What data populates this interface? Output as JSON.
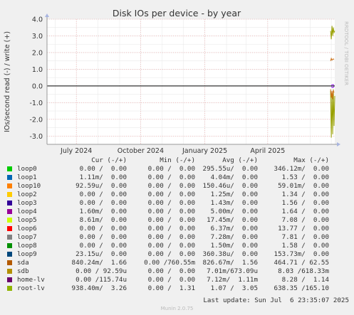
{
  "chart_data": {
    "type": "line",
    "title": "Disk IOs per device - by year",
    "ylabel": "IOs/second read (-) / write (+)",
    "ylim": [
      -3.5,
      4.0
    ],
    "yticks": [
      "4.0",
      "3.0",
      "2.0",
      "1.0",
      "0.0",
      "-1.0",
      "-2.0",
      "-3.0"
    ],
    "ytick_values": [
      4,
      3,
      2,
      1,
      0,
      -1,
      -2,
      -3
    ],
    "xlim": [
      "2024-05-20",
      "2025-07-06"
    ],
    "xticks": [
      {
        "label": "July 2024",
        "date": "2024-07-01"
      },
      {
        "label": "October 2024",
        "date": "2024-10-01"
      },
      {
        "label": "January 2025",
        "date": "2025-01-01"
      },
      {
        "label": "April 2025",
        "date": "2025-04-01"
      }
    ],
    "grid": true,
    "side_label": "RRDTOOL / TOBI OETIKER",
    "series": [
      {
        "name": "root-lv",
        "color": "#98a000",
        "x": [
          "2025-06-30",
          "2025-07-01",
          "2025-07-02",
          "2025-07-03",
          "2025-07-04",
          "2025-07-05",
          "2025-07-06"
        ],
        "write": [
          3.3,
          2.8,
          3.6,
          3.0,
          3.5,
          3.2,
          3.3
        ],
        "read": [
          -0.3,
          -3.1,
          -0.4,
          -2.9,
          -0.2,
          -2.4,
          -0.6
        ]
      },
      {
        "name": "sda",
        "color": "#cc7016",
        "x": [
          "2025-06-30",
          "2025-07-01",
          "2025-07-02",
          "2025-07-03",
          "2025-07-04",
          "2025-07-05"
        ],
        "write": [
          1.5,
          1.65,
          1.55,
          1.6,
          1.62,
          1.58
        ],
        "read": [
          -0.2,
          -0.7,
          -0.3,
          -0.8,
          -0.25,
          -0.4
        ]
      },
      {
        "name": "home-lv",
        "color": "#8c00ff",
        "x": [
          "2025-07-01",
          "2025-07-03",
          "2025-07-05"
        ],
        "write": [
          0.05,
          0.08,
          0.06
        ],
        "read": [
          -0.05,
          -0.1,
          -0.04
        ]
      }
    ]
  },
  "legend": {
    "headers": [
      "Cur (-/+)",
      "Min (-/+)",
      "Avg (-/+)",
      "Max (-/+)"
    ],
    "rows": [
      {
        "name": "loop0",
        "color": "#00cc00",
        "cur": "0.00 /  0.00",
        "min": "0.00 /  0.00",
        "avg": "295.55u/  0.00",
        "max": "346.12m/  0.00"
      },
      {
        "name": "loop1",
        "color": "#0066b3",
        "cur": "1.11m/  0.00",
        "min": "0.00 /  0.00",
        "avg": "4.04m/  0.00",
        "max": "1.53 /  0.00"
      },
      {
        "name": "loop10",
        "color": "#ff8000",
        "cur": "92.59u/  0.00",
        "min": "0.00 /  0.00",
        "avg": "150.46u/  0.00",
        "max": "59.01m/  0.00"
      },
      {
        "name": "loop2",
        "color": "#ffcc00",
        "cur": "0.00 /  0.00",
        "min": "0.00 /  0.00",
        "avg": "1.25m/  0.00",
        "max": "1.34 /  0.00"
      },
      {
        "name": "loop3",
        "color": "#330099",
        "cur": "0.00 /  0.00",
        "min": "0.00 /  0.00",
        "avg": "1.43m/  0.00",
        "max": "1.56 /  0.00"
      },
      {
        "name": "loop4",
        "color": "#990099",
        "cur": "1.60m/  0.00",
        "min": "0.00 /  0.00",
        "avg": "5.00m/  0.00",
        "max": "1.64 /  0.00"
      },
      {
        "name": "loop5",
        "color": "#ccff00",
        "cur": "8.61m/  0.00",
        "min": "0.00 /  0.00",
        "avg": "17.45m/  0.00",
        "max": "7.08 /  0.00"
      },
      {
        "name": "loop6",
        "color": "#ff0000",
        "cur": "0.00 /  0.00",
        "min": "0.00 /  0.00",
        "avg": "6.37m/  0.00",
        "max": "13.77 /  0.00"
      },
      {
        "name": "loop7",
        "color": "#808080",
        "cur": "0.00 /  0.00",
        "min": "0.00 /  0.00",
        "avg": "7.28m/  0.00",
        "max": "7.81 /  0.00"
      },
      {
        "name": "loop8",
        "color": "#008f00",
        "cur": "0.00 /  0.00",
        "min": "0.00 /  0.00",
        "avg": "1.50m/  0.00",
        "max": "1.58 /  0.00"
      },
      {
        "name": "loop9",
        "color": "#00487d",
        "cur": "23.15u/  0.00",
        "min": "0.00 /  0.00",
        "avg": "360.38u/  0.00",
        "max": "153.73m/  0.00"
      },
      {
        "name": "sda",
        "color": "#b35a00",
        "cur": "840.24m/  1.66",
        "min": "0.00 /760.55m",
        "avg": "826.67m/  1.56",
        "max": "464.71 / 62.55"
      },
      {
        "name": "sdb",
        "color": "#b38f00",
        "cur": "0.00 / 92.59u",
        "min": "0.00 /  0.00",
        "avg": "7.01m/673.09u",
        "max": "8.03 /618.33m"
      },
      {
        "name": "home-lv",
        "color": "#6b006b",
        "cur": "0.00 /115.74u",
        "min": "0.00 /  0.00",
        "avg": "7.12m/  1.11m",
        "max": "8.28 /  1.14"
      },
      {
        "name": "root-lv",
        "color": "#8fb300",
        "cur": "938.40m/  3.26",
        "min": "0.00 /  1.31",
        "avg": "1.07 /  3.05",
        "max": "638.35 /165.10"
      }
    ]
  },
  "footer": {
    "last_update": "Last update: Sun Jul  6 23:35:07 2025",
    "version": "Munin 2.0.75"
  }
}
